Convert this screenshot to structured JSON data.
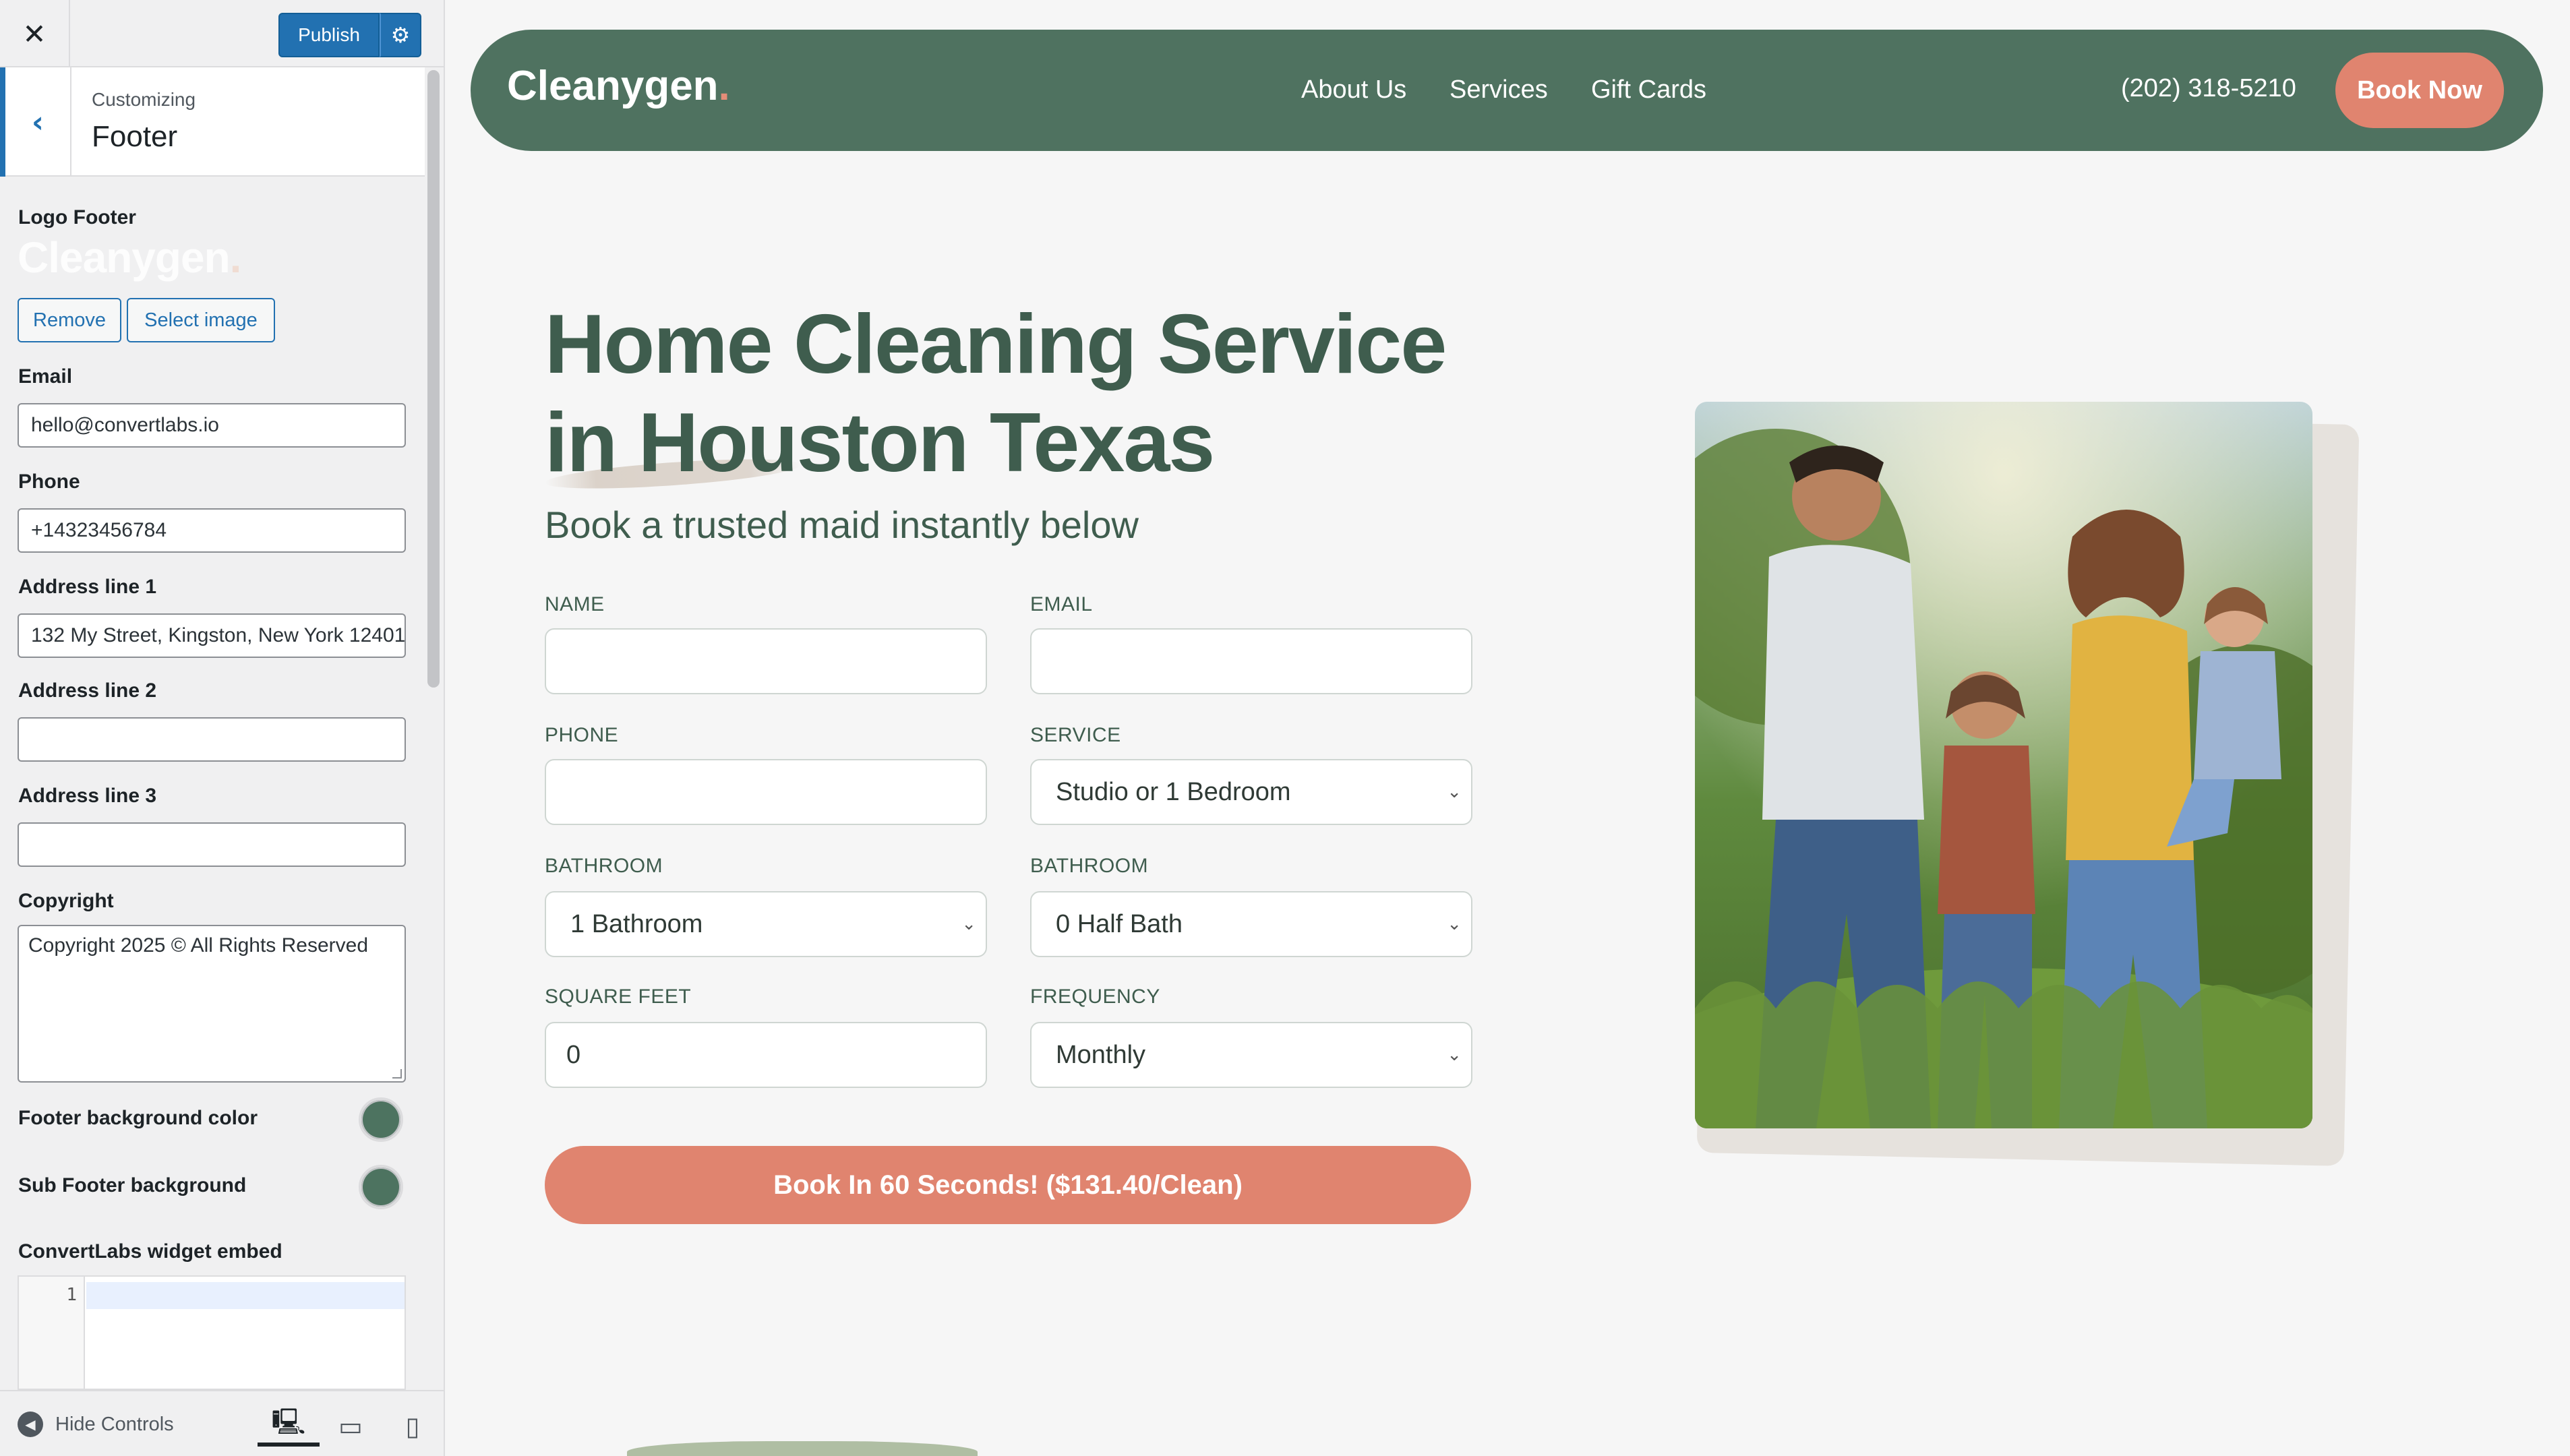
{
  "customizer": {
    "publish_label": "Publish",
    "customizing_label": "Customizing",
    "section_title": "Footer",
    "logo_footer_label": "Logo Footer",
    "logo_text": "Cleanygen",
    "logo_dot": ".",
    "remove_label": "Remove",
    "select_image_label": "Select image",
    "email_label": "Email",
    "email_value": "hello@convertlabs.io",
    "phone_label": "Phone",
    "phone_value": "+14323456784",
    "address1_label": "Address line 1",
    "address1_value": "132 My Street, Kingston, New York 12401",
    "address2_label": "Address line 2",
    "address2_value": "",
    "address3_label": "Address line 3",
    "address3_value": "",
    "copyright_label": "Copyright",
    "copyright_value": "Copyright 2025 © All Rights Reserved",
    "footer_bg_label": "Footer background color",
    "sub_footer_bg_label": "Sub Footer background",
    "footer_bg_color": "#4d7360",
    "widget_label": "ConvertLabs widget embed",
    "code_line_number": "1",
    "hide_controls_label": "Hide Controls"
  },
  "site": {
    "brand": "Cleanygen",
    "brand_dot": ".",
    "nav": [
      "About Us",
      "Services",
      "Gift Cards"
    ],
    "phone": "(202) 318-5210",
    "book_now": "Book Now",
    "hero_line1": "Home Cleaning Service",
    "hero_line2": "in Houston Texas",
    "hero_sub": "Book a trusted maid instantly below",
    "form": {
      "name_label": "NAME",
      "email_label": "EMAIL",
      "phone_label": "PHONE",
      "service_label": "SERVICE",
      "service_value": "Studio or 1 Bedroom",
      "bathroom_label": "BATHROOM",
      "bathroom_value": "1 Bathroom",
      "half_bath_label": "BATHROOM",
      "half_bath_value": "0 Half Bath",
      "sqft_label": "SQUARE FEET",
      "sqft_value": "0",
      "frequency_label": "FREQUENCY",
      "frequency_value": "Monthly",
      "cta": "Book In 60 Seconds! ($131.40/Clean)"
    },
    "colors": {
      "primary_green": "#4f7260",
      "accent_coral": "#e0846f",
      "heading_green": "#3f5d4e"
    }
  }
}
